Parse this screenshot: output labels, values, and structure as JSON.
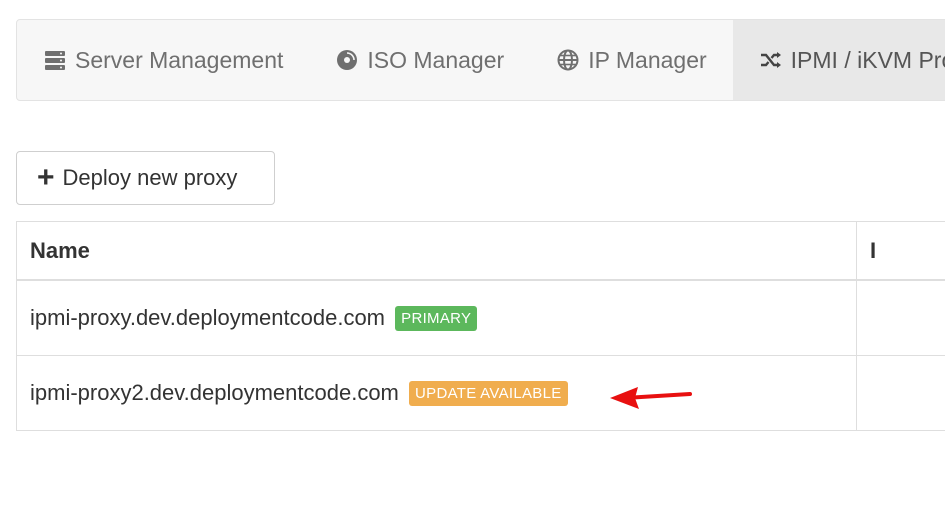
{
  "tabs": [
    {
      "label": "Server Management",
      "icon": "server-icon",
      "active": false
    },
    {
      "label": "ISO Manager",
      "icon": "disc-icon",
      "active": false
    },
    {
      "label": "IP Manager",
      "icon": "globe-icon",
      "active": false
    },
    {
      "label": "IPMI / iKVM Pro",
      "icon": "shuffle-icon",
      "active": true
    }
  ],
  "deploy_button": {
    "label": "Deploy new proxy",
    "icon": "plus-icon"
  },
  "table": {
    "headers": [
      "Name",
      "I"
    ],
    "rows": [
      {
        "name": "ipmi-proxy.dev.deploymentcode.com",
        "badge": "PRIMARY",
        "badge_color": "#5cb85c"
      },
      {
        "name": "ipmi-proxy2.dev.deploymentcode.com",
        "badge": "UPDATE AVAILABLE",
        "badge_color": "#f0ad4e"
      }
    ]
  },
  "annotation": {
    "arrow_color": "#e81010"
  }
}
